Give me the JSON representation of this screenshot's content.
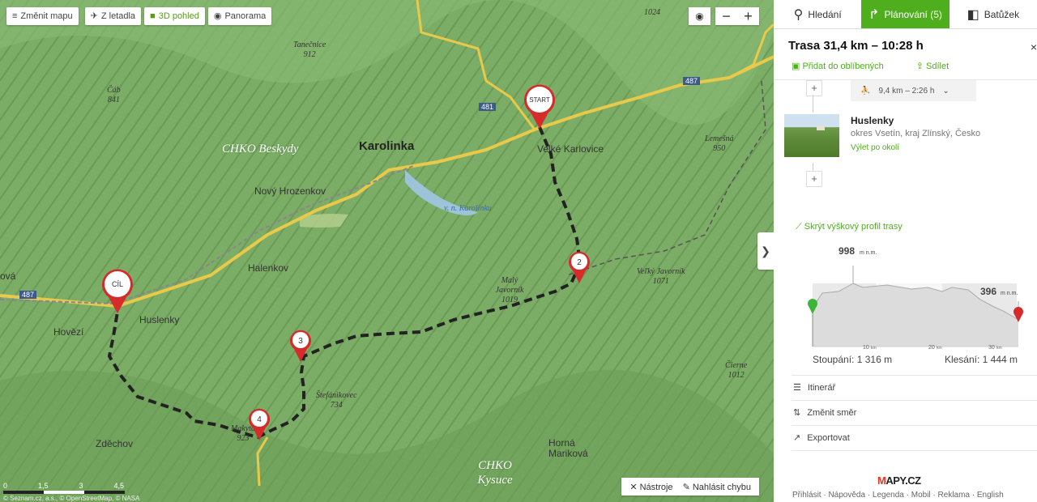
{
  "map": {
    "toolbar": {
      "change_map": "Změnit mapu",
      "from_plane": "Z letadla",
      "view_3d": "3D pohled",
      "panorama": "Panorama"
    },
    "zoom_out": "−",
    "zoom_in": "+",
    "expand_arrow": "❯",
    "pins": {
      "start": "START",
      "goal": "CÍL",
      "wp2": "2",
      "wp3": "3",
      "wp4": "4"
    },
    "labels": {
      "karolinka": "Karolinka",
      "chko_beskydy": "CHKO Beskydy",
      "chko_kysuce": "CHKO Kysuce",
      "novy_hrozenkov": "Nový  Hrozenkov",
      "halenkov": "Halenkov",
      "huslenky": "Huslenky",
      "hovezi": "Hovězí",
      "zdechov": "Zděchov",
      "horna_marikova": "Horná Mariková",
      "velke_karlovice": "Velké Karlovice",
      "vn_karolinku": "v. n. Karolinku",
      "tanecnice": "Tanečnice",
      "tanecnice_h": "912",
      "cab": "Čáb",
      "cab_h": "841",
      "lemesna": "Lemešná",
      "lemesna_h": "950",
      "velky_javornik": "Veľký Javorník",
      "velky_javornik_h": "1071",
      "maly_javornik": "Malý Javorník",
      "maly_javornik_h": "1019",
      "stefanikovec": "Štefánikovec",
      "stefanikovec_h": "734",
      "makyta": "Makyta",
      "makyta_h": "923",
      "cierne": "Čierne",
      "cierne_h": "1012",
      "vova": "ová",
      "pk1024": "1024",
      "road487a": "487",
      "road487b": "487",
      "road481": "481"
    },
    "scale": {
      "t0": "0",
      "t1": "1,5",
      "t2": "3",
      "t3": "4,5"
    },
    "copyright": "© Seznam.cz, a.s., © OpenStreetMap, © NASA",
    "tools": "Nástroje",
    "report": "Nahlásit chybu"
  },
  "panel": {
    "tabs": {
      "search": "Hledání",
      "plan": "Plánování (5)",
      "backpack": "Batůžek"
    },
    "title": "Trasa 31,4 km – 10:28 h",
    "close": "×",
    "add_fav": "Přidat do oblíbených",
    "share": "Sdílet",
    "segment": "9,4 km – 2:26 h",
    "place": {
      "name": "Huslenky",
      "location": "okres Vsetín, kraj Zlínský, Česko",
      "trip": "Výlet po okolí"
    },
    "plus": "+",
    "hide_profile": "Skrýt výškový profil trasy",
    "profile": {
      "max": "998",
      "max_unit": "m n.m.",
      "end": "396",
      "end_unit": "m n.m.",
      "km10": "10",
      "km20": "20",
      "km30": "30",
      "km_unit": "km",
      "climb": "Stoupání: 1 316 m",
      "descent": "Klesání: 1 444 m"
    },
    "menu": {
      "itinerary": "Itinerář",
      "reverse": "Změnit směr",
      "export": "Exportovat"
    },
    "logo_a": "M",
    "logo_b": "APY.CZ",
    "footer": "Přihlásit · Nápověda · Legenda · Mobil · Reklama · English"
  }
}
